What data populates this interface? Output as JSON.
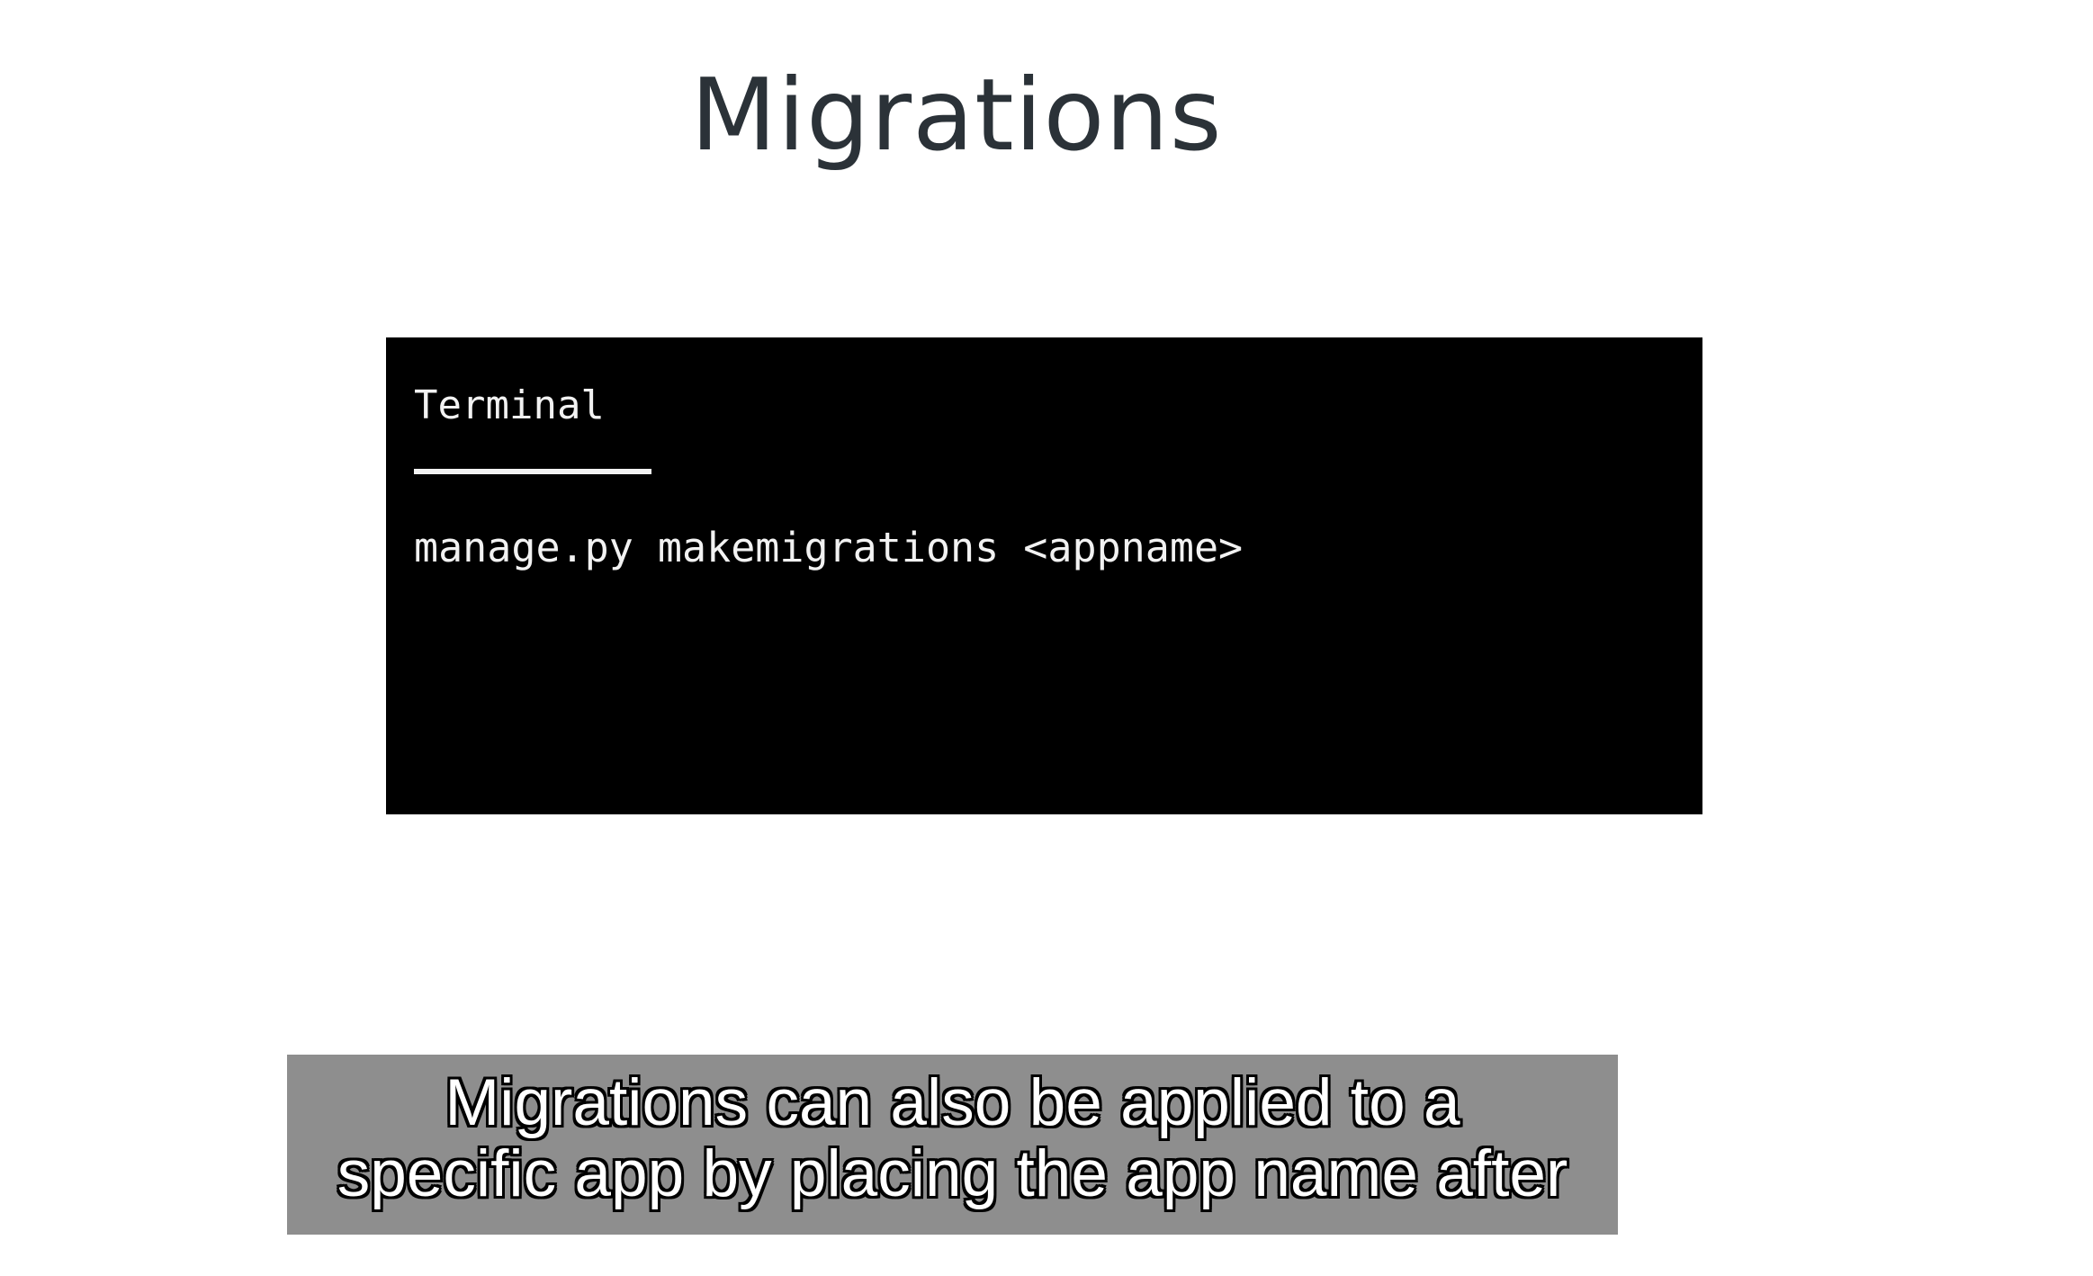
{
  "slide": {
    "title": "Migrations"
  },
  "terminal": {
    "tab_label": "Terminal",
    "command": "manage.py makemigrations <appname>"
  },
  "caption": {
    "lines": [
      "Migrations can also be applied to a",
      "specific app by placing the app name after"
    ]
  }
}
